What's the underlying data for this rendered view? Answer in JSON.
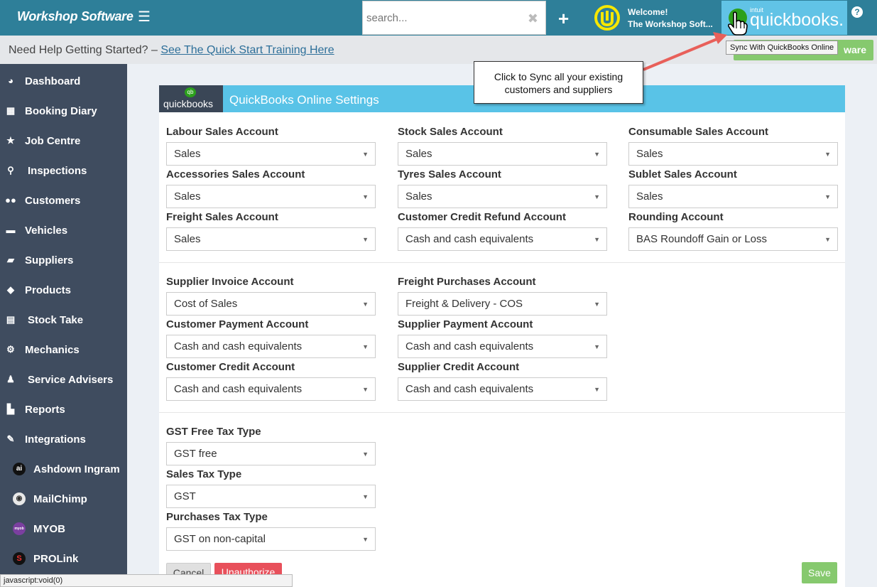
{
  "header": {
    "brand": "Workshop Software",
    "menu_icon": "hamburger-icon",
    "search_placeholder": "search...",
    "welcome_line1": "Welcome!",
    "welcome_line2": "The Workshop Soft...",
    "qb_intuit": "intuit",
    "qb_word": "quickbooks.",
    "help_glyph": "?"
  },
  "helpbar": {
    "text": "Need Help Getting Started? – ",
    "link": "See The Quick Start Training Here",
    "green_button_partial": "ware"
  },
  "tooltip": "Sync With QuickBooks Online",
  "callout": {
    "line1": "Click to Sync all your existing",
    "line2": "customers and suppliers"
  },
  "sidebar": {
    "items": [
      {
        "label": "Dashboard",
        "icon": "dashboard-icon"
      },
      {
        "label": "Booking Diary",
        "icon": "calendar-icon"
      },
      {
        "label": "Job Centre",
        "icon": "star-icon"
      },
      {
        "label": "Inspections",
        "icon": "search-icon"
      },
      {
        "label": "Customers",
        "icon": "users-icon"
      },
      {
        "label": "Vehicles",
        "icon": "car-icon"
      },
      {
        "label": "Suppliers",
        "icon": "truck-icon"
      },
      {
        "label": "Products",
        "icon": "tags-icon"
      },
      {
        "label": "Stock Take",
        "icon": "clipboard-icon"
      },
      {
        "label": "Mechanics",
        "icon": "cogs-icon"
      },
      {
        "label": "Service Advisers",
        "icon": "user-tie-icon"
      },
      {
        "label": "Reports",
        "icon": "bar-chart-icon"
      },
      {
        "label": "Integrations",
        "icon": "plug-icon"
      },
      {
        "label": "Ashdown Ingram",
        "icon": "ashdown-ingram-logo-icon"
      },
      {
        "label": "MailChimp",
        "icon": "mailchimp-logo-icon"
      },
      {
        "label": "MYOB",
        "icon": "myob-logo-icon"
      },
      {
        "label": "PROLink",
        "icon": "prolink-logo-icon"
      }
    ]
  },
  "card": {
    "logo_text": "quickbooks",
    "logo_badge": "qb",
    "title": "QuickBooks Online Settings"
  },
  "fields": {
    "labour_sales": {
      "label": "Labour Sales Account",
      "value": "Sales"
    },
    "stock_sales": {
      "label": "Stock Sales Account",
      "value": "Sales"
    },
    "consumable_sales": {
      "label": "Consumable Sales Account",
      "value": "Sales"
    },
    "accessories_sales": {
      "label": "Accessories Sales Account",
      "value": "Sales"
    },
    "tyres_sales": {
      "label": "Tyres Sales Account",
      "value": "Sales"
    },
    "sublet_sales": {
      "label": "Sublet Sales Account",
      "value": "Sales"
    },
    "freight_sales": {
      "label": "Freight Sales Account",
      "value": "Sales"
    },
    "customer_credit_refund": {
      "label": "Customer Credit Refund Account",
      "value": "Cash and cash equivalents"
    },
    "rounding": {
      "label": "Rounding Account",
      "value": "BAS Roundoff Gain or Loss"
    },
    "supplier_invoice": {
      "label": "Supplier Invoice Account",
      "value": "Cost of Sales"
    },
    "freight_purchases": {
      "label": "Freight Purchases Account",
      "value": "Freight & Delivery - COS"
    },
    "customer_payment": {
      "label": "Customer Payment Account",
      "value": "Cash and cash equivalents"
    },
    "supplier_payment": {
      "label": "Supplier Payment Account",
      "value": "Cash and cash equivalents"
    },
    "customer_credit": {
      "label": "Customer Credit Account",
      "value": "Cash and cash equivalents"
    },
    "supplier_credit": {
      "label": "Supplier Credit Account",
      "value": "Cash and cash equivalents"
    },
    "gst_free": {
      "label": "GST Free Tax Type",
      "value": "GST free"
    },
    "sales_tax": {
      "label": "Sales Tax Type",
      "value": "GST"
    },
    "purchases_tax": {
      "label": "Purchases Tax Type",
      "value": "GST on non-capital"
    }
  },
  "buttons": {
    "cancel": "Cancel",
    "unauthorize": "Unauthorize",
    "save": "Save"
  },
  "colors": {
    "topbar": "#2e7f99",
    "sidebar": "#3f4c5f",
    "card_header": "#59c3e7",
    "save": "#86c96e",
    "unauthorize": "#e8505b"
  },
  "statusbar": "javascript:void(0)"
}
